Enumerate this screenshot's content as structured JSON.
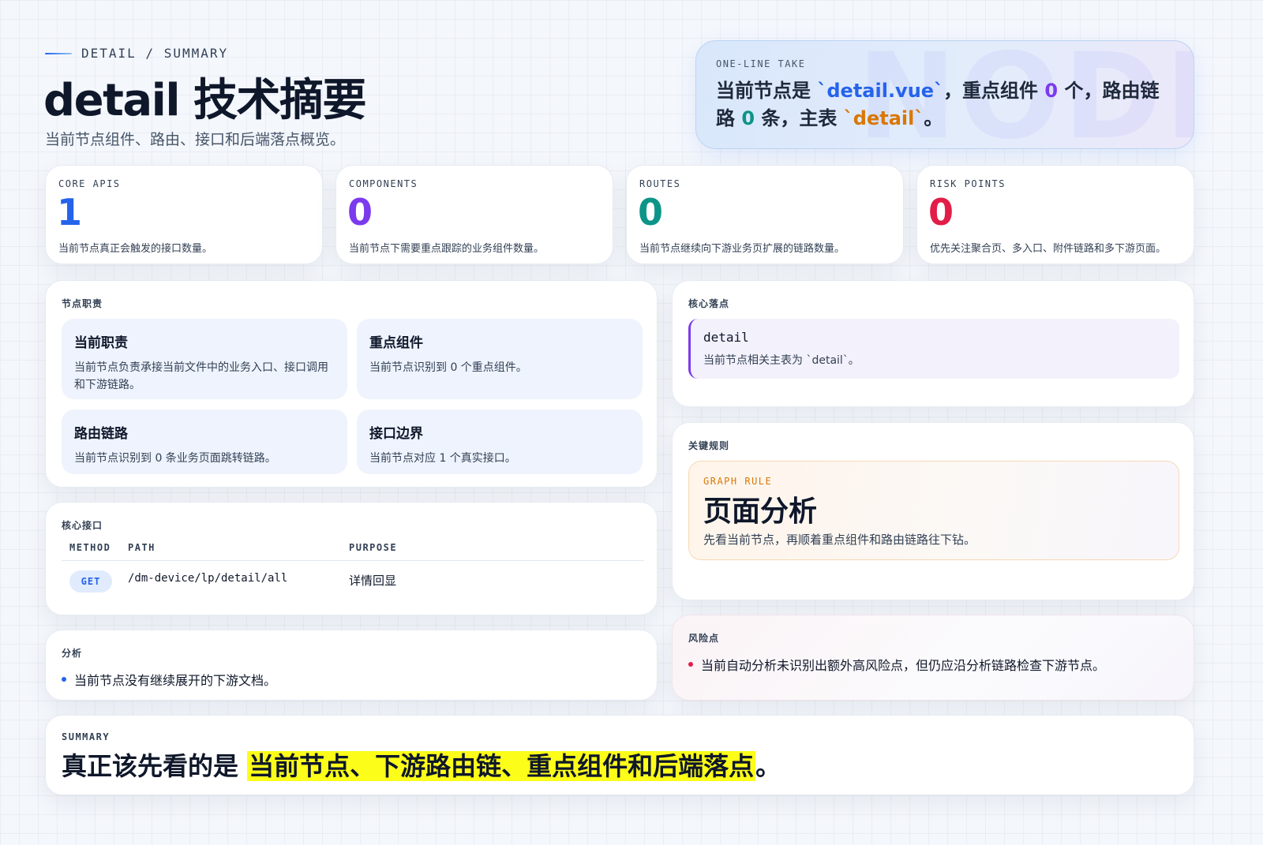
{
  "header": {
    "eyebrow": "DETAIL / SUMMARY",
    "title": "detail 技术摘要",
    "subtitle": "当前节点组件、路由、接口和后端落点概览。"
  },
  "one_line": {
    "label": "ONE-LINE TAKE",
    "watermark": "NODE",
    "prefix": "当前节点是 ",
    "file": "`detail.vue`",
    "mid1": "，重点组件 ",
    "components": "0",
    "mid2": " 个，路由链路 ",
    "routes": "0",
    "mid3": " 条，主表 ",
    "table": "`detail`",
    "suffix": "。"
  },
  "stats": [
    {
      "label": "CORE APIS",
      "value": "1",
      "desc": "当前节点真正会触发的接口数量。",
      "color": "#2563eb"
    },
    {
      "label": "COMPONENTS",
      "value": "0",
      "desc": "当前节点下需要重点跟踪的业务组件数量。",
      "color": "#7c3aed"
    },
    {
      "label": "ROUTES",
      "value": "0",
      "desc": "当前节点继续向下游业务页扩展的链路数量。",
      "color": "#0d9488"
    },
    {
      "label": "RISK POINTS",
      "value": "0",
      "desc": "优先关注聚合页、多入口、附件链路和多下游页面。",
      "color": "#e11d48"
    }
  ],
  "duties": {
    "title": "节点职责",
    "items": [
      {
        "title": "当前职责",
        "desc": "当前节点负责承接当前文件中的业务入口、接口调用和下游链路。"
      },
      {
        "title": "重点组件",
        "desc": "当前节点识别到 0 个重点组件。"
      },
      {
        "title": "路由链路",
        "desc": "当前节点识别到 0 条业务页面跳转链路。"
      },
      {
        "title": "接口边界",
        "desc": "当前节点对应 1 个真实接口。"
      }
    ]
  },
  "landing": {
    "title": "核心落点",
    "name": "detail",
    "desc": "当前节点相关主表为 `detail`。"
  },
  "rules": {
    "title": "关键规则",
    "label": "GRAPH RULE",
    "heading": "页面分析",
    "desc": "先看当前节点，再顺着重点组件和路由链路往下钻。"
  },
  "apis": {
    "title": "核心接口",
    "columns": {
      "method": "METHOD",
      "path": "PATH",
      "purpose": "PURPOSE"
    },
    "rows": [
      {
        "method": "GET",
        "path": "/dm-device/lp/detail/all",
        "purpose": "详情回显"
      }
    ]
  },
  "analysis": {
    "title": "分析",
    "items": [
      "当前节点没有继续展开的下游文档。"
    ]
  },
  "risks": {
    "title": "风险点",
    "items": [
      "当前自动分析未识别出额外高风险点，但仍应沿分析链路检查下游节点。"
    ]
  },
  "summary": {
    "label": "SUMMARY",
    "lead": "真正该先看的是 ",
    "highlight": "当前节点、下游路由链、重点组件和后端落点",
    "tail": "。"
  }
}
